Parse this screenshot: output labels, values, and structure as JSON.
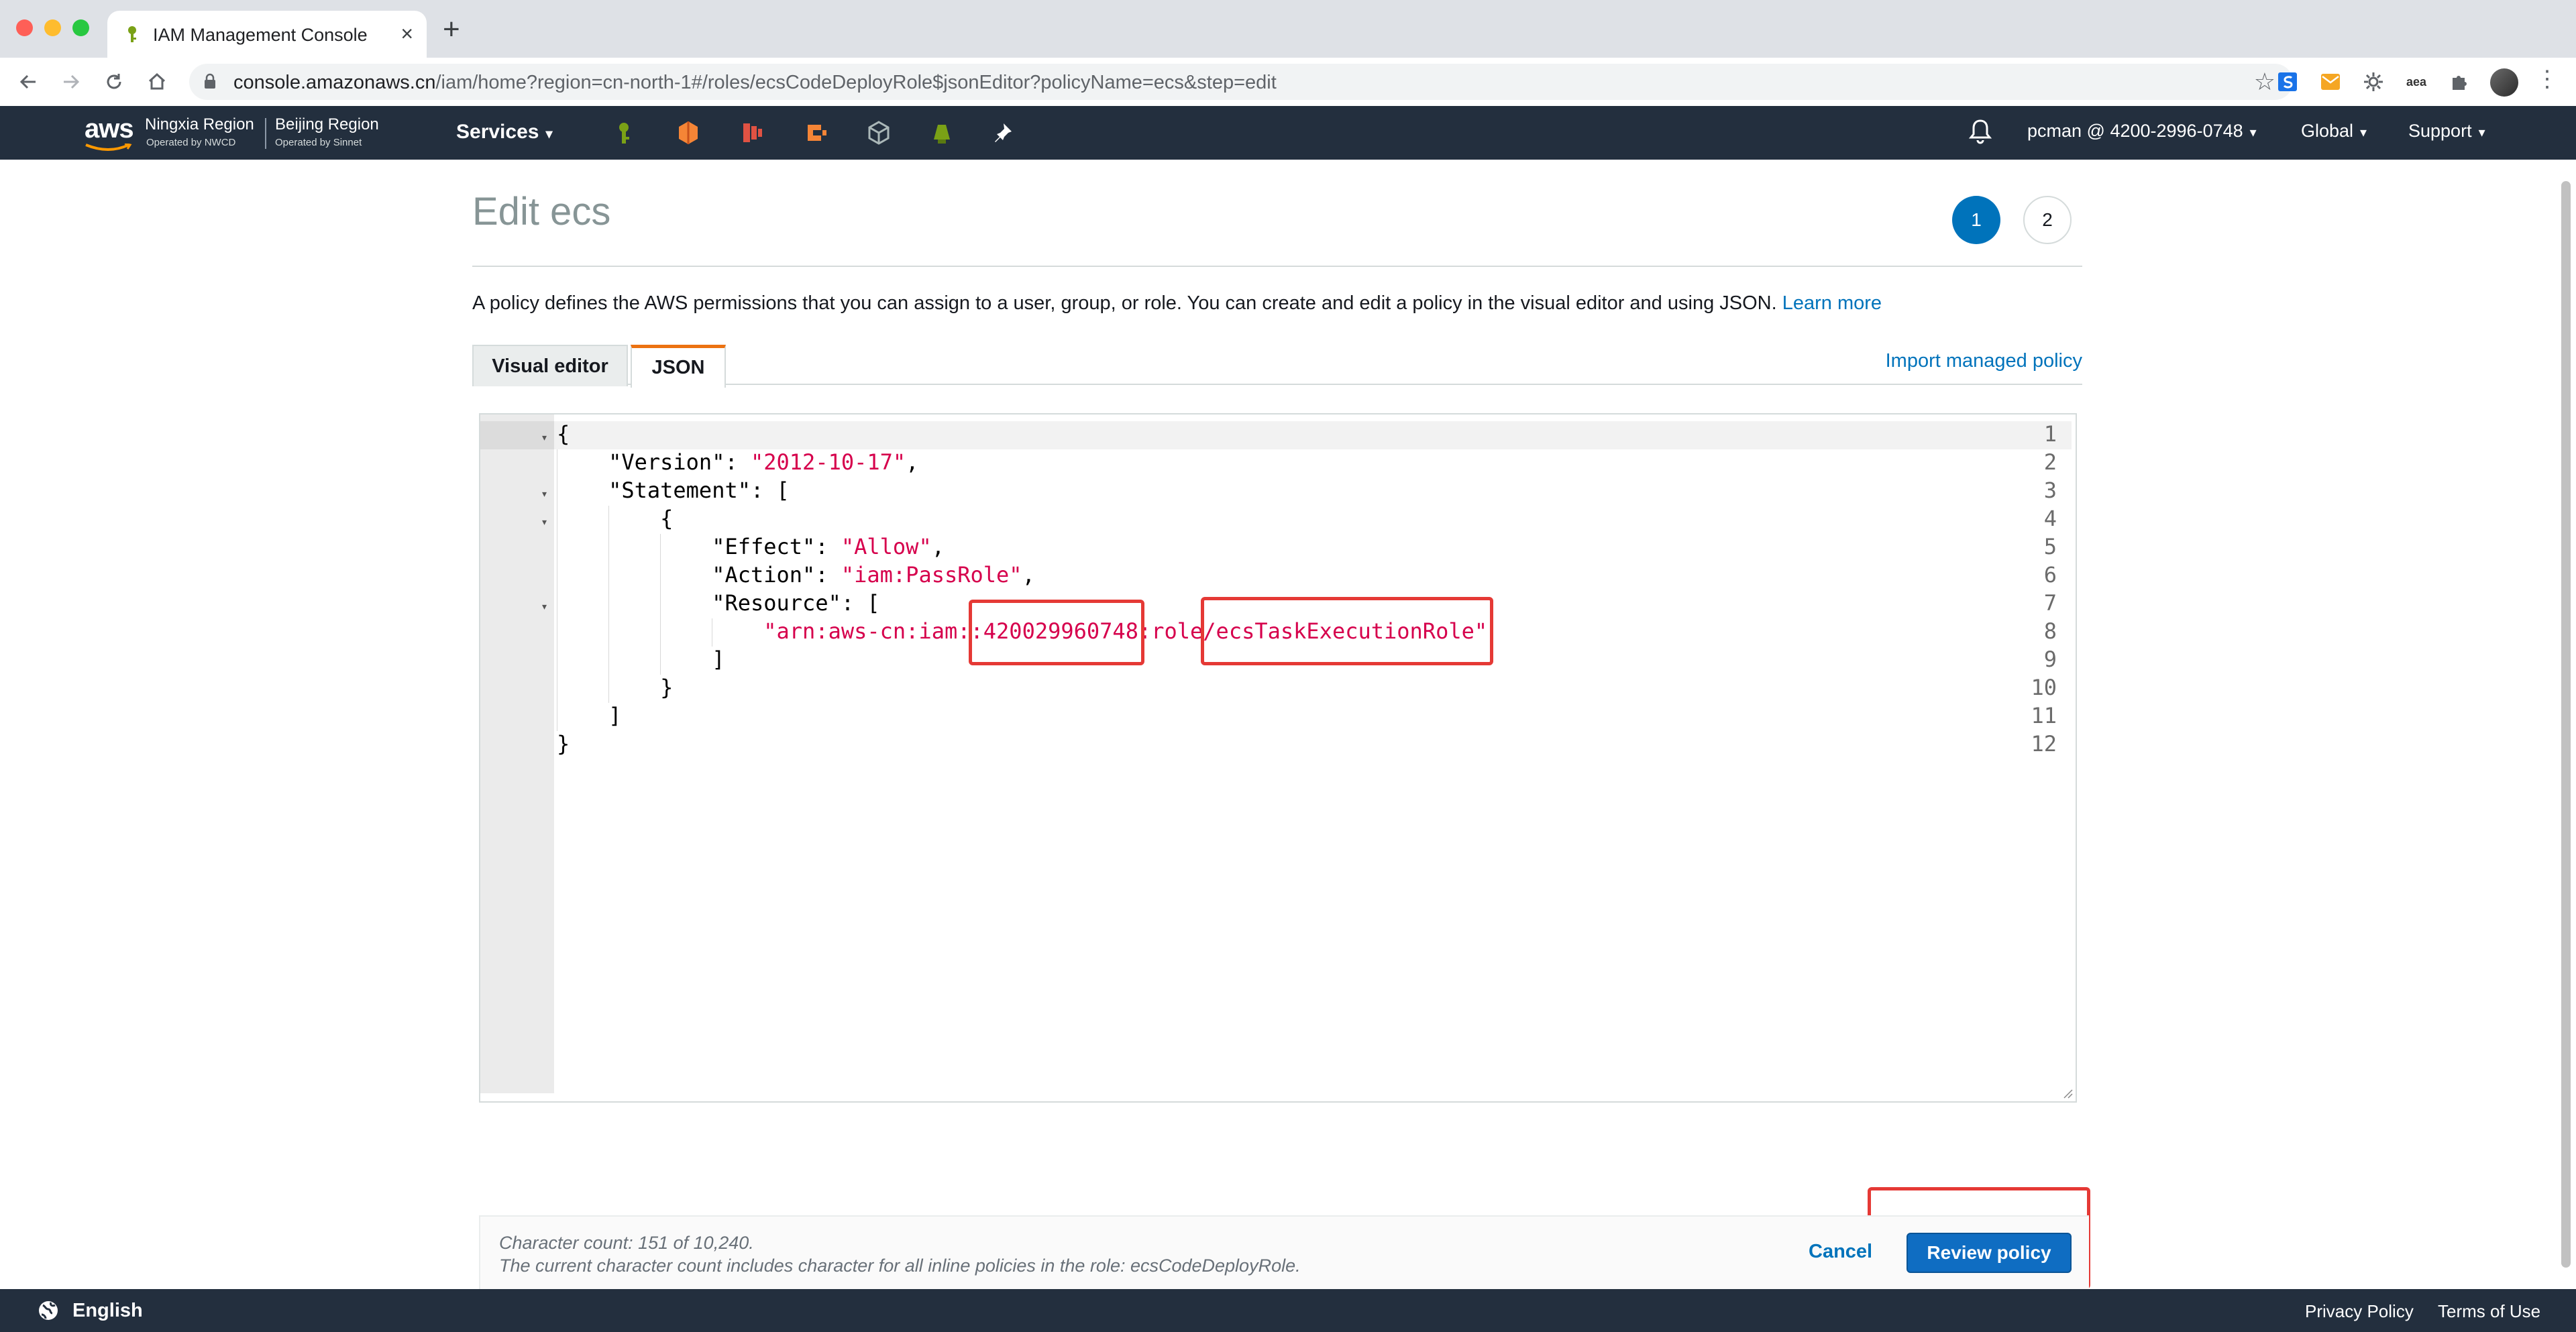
{
  "browser": {
    "tab_title": "IAM Management Console",
    "tab_close": "×",
    "new_tab": "+",
    "url_host": "console.amazonaws.cn",
    "url_path": "/iam/home?region=cn-north-1#/roles/ecsCodeDeployRole$jsonEditor?policyName=ecs&step=edit",
    "ext_icons": [
      "s-extension-icon",
      "mail-extension-icon",
      "gear-extension-icon",
      "aea-extension-icon",
      "puzzle-extension-icon"
    ]
  },
  "aws_nav": {
    "logo": "aws",
    "regions": [
      {
        "name": "Ningxia Region",
        "operator": "Operated by NWCD"
      },
      {
        "name": "Beijing Region",
        "operator": "Operated by Sinnet"
      }
    ],
    "services_label": "Services",
    "account_label": "pcman @ 4200-2996-0748",
    "global_label": "Global",
    "support_label": "Support",
    "caret": "▾"
  },
  "page": {
    "title": "Edit ecs",
    "steps": [
      "1",
      "2"
    ],
    "intro_text": "A policy defines the AWS permissions that you can assign to a user, group, or role. You can create and edit a policy in the visual editor and using JSON. ",
    "learn_more": "Learn more",
    "tabs": {
      "visual": "Visual editor",
      "json": "JSON"
    },
    "import_link": "Import managed policy"
  },
  "editor": {
    "line_numbers": [
      "1",
      "2",
      "3",
      "4",
      "5",
      "6",
      "7",
      "8",
      "9",
      "10",
      "11",
      "12"
    ],
    "lines": {
      "l1": "{",
      "l2_key": "    \"Version\": ",
      "l2_val": "\"2012-10-17\"",
      "l2_end": ",",
      "l3": "    \"Statement\": [",
      "l4": "        {",
      "l5_key": "            \"Effect\": ",
      "l5_val": "\"Allow\"",
      "l5_end": ",",
      "l6_key": "            \"Action\": ",
      "l6_val": "\"iam:PassRole\"",
      "l6_end": ",",
      "l7": "            \"Resource\": [",
      "l8_pre": "                ",
      "l8_val": "\"arn:aws-cn:iam::420029960748:role/ecsTaskExecutionRole\"",
      "l9": "            ]",
      "l10": "        }",
      "l11": "    ]",
      "l12": "}"
    }
  },
  "footer": {
    "char_count": "Character count: 151 of 10,240.",
    "char_note": "The current character count includes character for all inline policies in the role: ecsCodeDeployRole.",
    "cancel_label": "Cancel",
    "review_label": "Review policy"
  },
  "bottom_bar": {
    "language": "English",
    "privacy": "Privacy Policy",
    "terms": "Terms of Use"
  },
  "colors": {
    "aws_nav_bg": "#232f3e",
    "primary_blue": "#0073bb",
    "tab_accent": "#ec7211",
    "annotation_red": "#e53935",
    "json_string": "#d6004c"
  }
}
